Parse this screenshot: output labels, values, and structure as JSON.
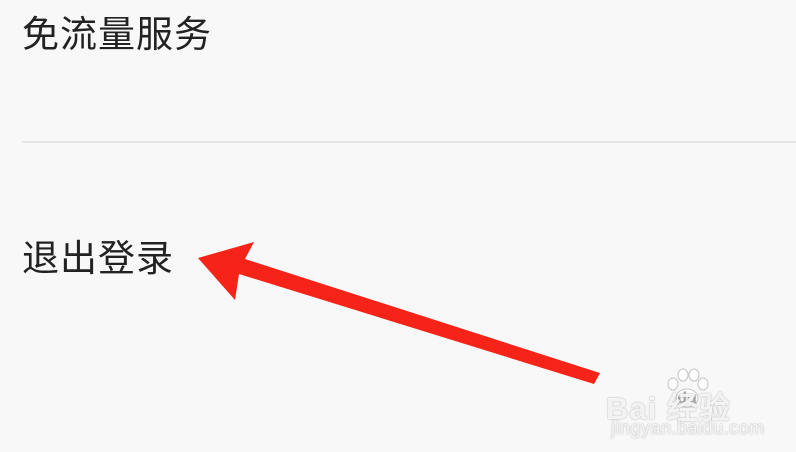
{
  "settings": {
    "items": [
      {
        "label": "免流量服务"
      },
      {
        "label": "退出登录"
      }
    ]
  },
  "watermark": {
    "brand": "Bai  经验",
    "subtext": "jingyan.baidu.com"
  },
  "colors": {
    "background": "#f8f8f8",
    "text": "#222222",
    "divider": "#e6e6e6",
    "arrow": "#f52318"
  },
  "icons": {
    "annotation": "red-arrow-icon",
    "watermark": "baidu-paw-icon"
  }
}
